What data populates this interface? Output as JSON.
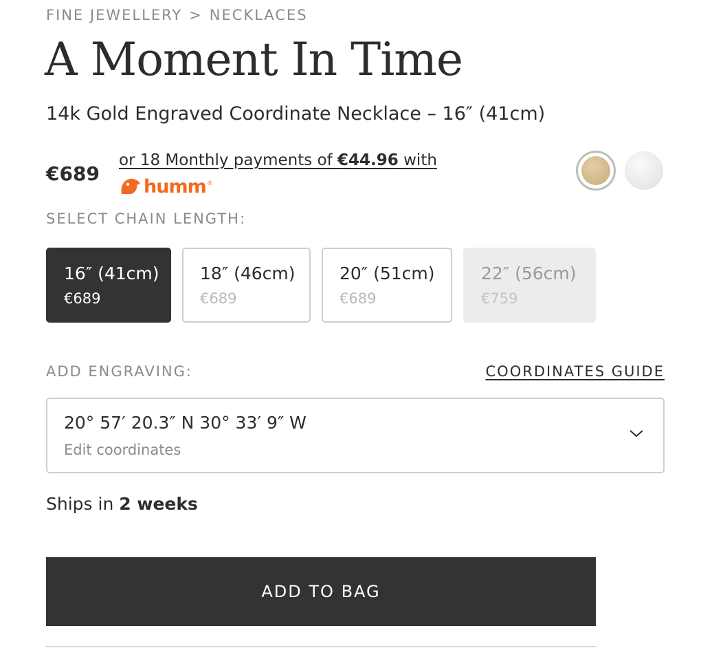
{
  "breadcrumb": {
    "items": [
      "FINE JEWELLERY",
      "NECKLACES"
    ],
    "separator": ">"
  },
  "product": {
    "title": "A Moment In Time",
    "subtitle": "14k Gold Engraved Coordinate Necklace – 16″ (41cm)",
    "price": "€689"
  },
  "finance": {
    "prefix": "or 18 Monthly payments of ",
    "amount": "€44.96",
    "suffix": " with",
    "provider": "humm",
    "provider_color": "#f26b21"
  },
  "swatches": [
    {
      "name": "Gold",
      "color": "#d4bb8e",
      "selected": true
    },
    {
      "name": "White Gold",
      "color": "#e8e8e8",
      "selected": false
    }
  ],
  "chain_length": {
    "label": "SELECT CHAIN LENGTH:",
    "options": [
      {
        "length": "16″ (41cm)",
        "price": "€689",
        "state": "selected"
      },
      {
        "length": "18″ (46cm)",
        "price": "€689",
        "state": "available"
      },
      {
        "length": "20″ (51cm)",
        "price": "€689",
        "state": "available"
      },
      {
        "length": "22″ (56cm)",
        "price": "€759",
        "state": "disabled"
      }
    ]
  },
  "engraving": {
    "label": "ADD ENGRAVING:",
    "guide_link": "COORDINATES GUIDE",
    "value": "20° 57′ 20.3″ N 30° 33′ 9″ W",
    "edit_label": "Edit coordinates"
  },
  "shipping": {
    "prefix": "Ships in",
    "duration": "2 weeks"
  },
  "cta": {
    "add_to_bag": "ADD TO BAG"
  },
  "colors": {
    "text": "#2d2d2d",
    "muted": "#8a8a8a",
    "selected_bg": "#333333",
    "disabled_bg": "#ececec",
    "border": "#cfcfcf"
  }
}
